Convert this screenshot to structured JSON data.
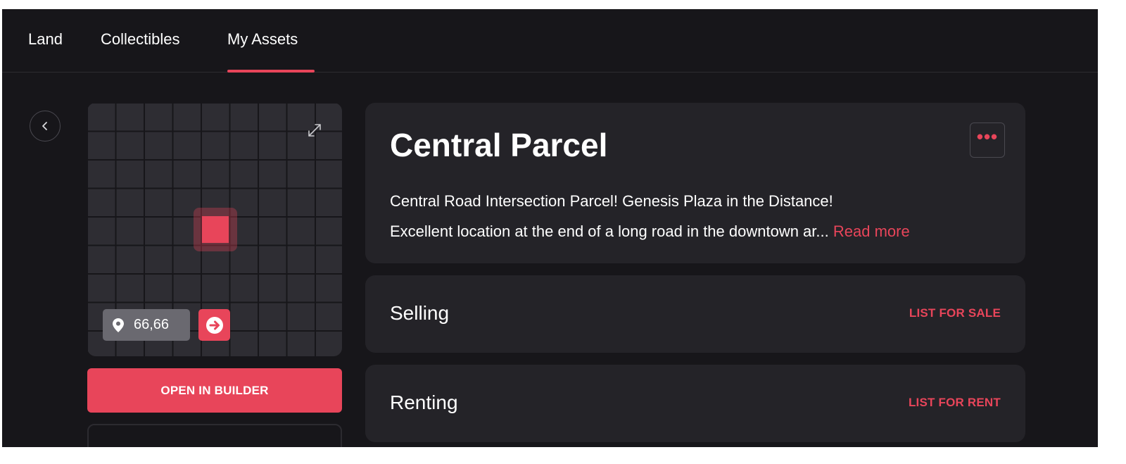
{
  "nav": {
    "tabs": [
      {
        "label": "Land"
      },
      {
        "label": "Collectibles"
      },
      {
        "label": "My Assets",
        "active": true
      }
    ]
  },
  "parcel": {
    "coords": "66,66",
    "open_builder_label": "OPEN IN BUILDER"
  },
  "detail": {
    "title": "Central Parcel",
    "description_line1": "Central Road Intersection Parcel! Genesis Plaza in the Distance!",
    "description_line2": "Excellent location at the end of a long road in the downtown ar...",
    "read_more_label": "Read more"
  },
  "selling": {
    "label": "Selling",
    "action_label": "LIST FOR SALE"
  },
  "renting": {
    "label": "Renting",
    "action_label": "LIST FOR RENT"
  },
  "icons": {
    "back": "chevron-left-icon",
    "expand": "expand-icon",
    "location": "map-pin-icon",
    "jump": "arrow-right-circle-icon",
    "more": "more-horizontal-icon"
  },
  "colors": {
    "background": "#17161a",
    "card": "#242328",
    "accent": "#e8455a",
    "map_tile": "#2e2d33",
    "badge": "#6a6970"
  }
}
